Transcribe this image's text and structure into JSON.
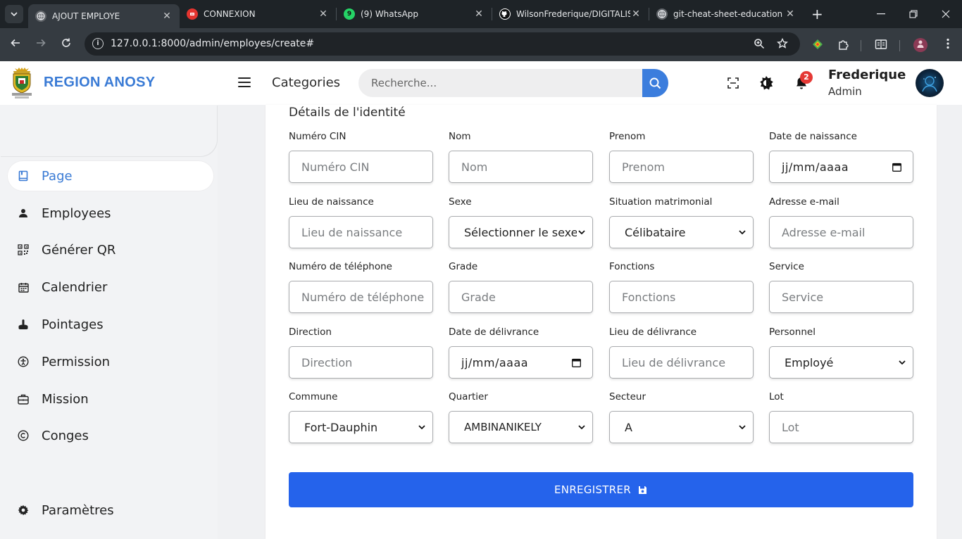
{
  "browser": {
    "tabs": [
      {
        "title": "AJOUT EMPLOYE",
        "icon": "globe-icon",
        "active": true
      },
      {
        "title": "CONNEXION",
        "icon": "laravel-icon",
        "active": false
      },
      {
        "title": "(9) WhatsApp",
        "icon": "whatsapp-icon",
        "badge": "9",
        "active": false
      },
      {
        "title": "WilsonFrederique/DIGITALIS",
        "icon": "github-icon",
        "active": false
      },
      {
        "title": "git-cheat-sheet-education",
        "icon": "globe-icon",
        "active": false
      }
    ],
    "url": "127.0.0.1:8000/admin/employes/create#"
  },
  "header": {
    "brand": "REGION ANOSY",
    "categories_label": "Categories",
    "search_placeholder": "Recherche...",
    "notification_count": "2",
    "user_name": "Frederique",
    "user_role": "Admin"
  },
  "sidebar": {
    "items": [
      {
        "label": "Page",
        "icon": "book-icon",
        "active": true
      },
      {
        "label": "Employees",
        "icon": "user-icon",
        "active": false
      },
      {
        "label": "Générer QR",
        "icon": "qrcode-icon",
        "active": false
      },
      {
        "label": "Calendrier",
        "icon": "calendar-icon",
        "active": false
      },
      {
        "label": "Pointages",
        "icon": "hand-point-icon",
        "active": false
      },
      {
        "label": "Permission",
        "icon": "accessibility-icon",
        "active": false
      },
      {
        "label": "Mission",
        "icon": "briefcase-icon",
        "active": false
      },
      {
        "label": "Conges",
        "icon": "copyright-icon",
        "active": false
      }
    ],
    "settings_label": "Paramètres"
  },
  "form": {
    "section_title": "Détails de l'identité",
    "fields": {
      "cin": {
        "label": "Numéro CIN",
        "placeholder": "Numéro CIN"
      },
      "nom": {
        "label": "Nom",
        "placeholder": "Nom"
      },
      "prenom": {
        "label": "Prenom",
        "placeholder": "Prenom"
      },
      "date_naissance": {
        "label": "Date de naissance",
        "value": "jj/mm/aaaa"
      },
      "lieu_naissance": {
        "label": "Lieu de naissance",
        "placeholder": "Lieu de naissance"
      },
      "sexe": {
        "label": "Sexe",
        "value": "Sélectionner le sexe"
      },
      "situation": {
        "label": "Situation matrimonial",
        "value": "Célibataire"
      },
      "email": {
        "label": "Adresse e-mail",
        "placeholder": "Adresse e-mail"
      },
      "telephone": {
        "label": "Numéro de téléphone",
        "placeholder": "Numéro de téléphone"
      },
      "grade": {
        "label": "Grade",
        "placeholder": "Grade"
      },
      "fonctions": {
        "label": "Fonctions",
        "placeholder": "Fonctions"
      },
      "service": {
        "label": "Service",
        "placeholder": "Service"
      },
      "direction": {
        "label": "Direction",
        "placeholder": "Direction"
      },
      "date_delivrance": {
        "label": "Date de délivrance",
        "value": "jj/mm/aaaa"
      },
      "lieu_delivrance": {
        "label": "Lieu de délivrance",
        "placeholder": "Lieu de délivrance"
      },
      "personnel": {
        "label": "Personnel",
        "value": "Employé"
      },
      "commune": {
        "label": "Commune",
        "value": "Fort-Dauphin"
      },
      "quartier": {
        "label": "Quartier",
        "value": "AMBINANIKELY"
      },
      "secteur": {
        "label": "Secteur",
        "value": "A"
      },
      "lot": {
        "label": "Lot",
        "placeholder": "Lot"
      }
    },
    "submit_label": "ENREGISTRER"
  },
  "colors": {
    "brand": "#3a7bd5",
    "primary_button": "#2563eb",
    "search_button": "#3b7ddd",
    "notification_badge": "#e53935"
  }
}
